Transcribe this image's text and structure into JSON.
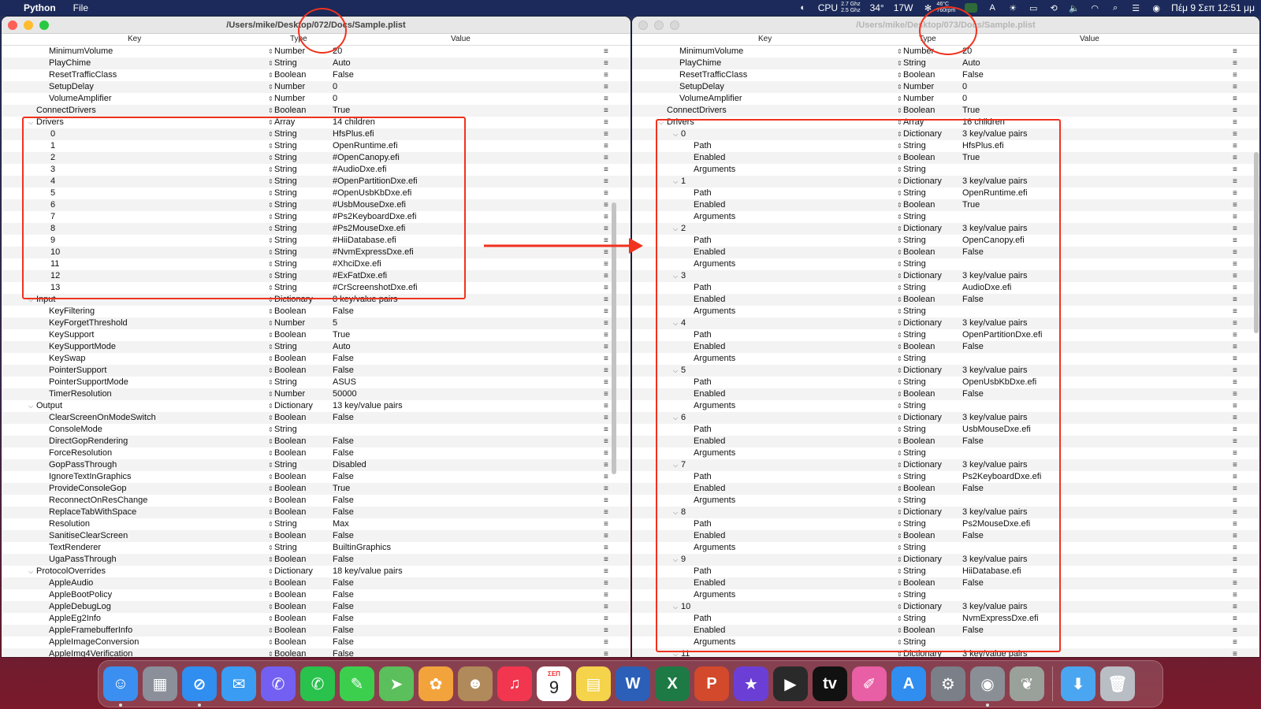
{
  "menubar": {
    "app_name": "Python",
    "menu_file": "File",
    "cpu_label": "CPU",
    "cpu_freq_1": "2.7 Ghz",
    "cpu_freq_2": "2.5 Ghz",
    "temperature": "34°",
    "power": "17W",
    "gpu_temp": "46°C",
    "fan_rpm": "760rpm",
    "datetime": "Πέμ 9 Σεπ  12:51 μμ"
  },
  "left_window": {
    "title": "/Users/mike/Desktop/072/Docs/Sample.plist",
    "headers": {
      "key": "Key",
      "type": "Type",
      "value": "Value"
    },
    "rows": [
      {
        "key": "MinimumVolume",
        "type": "Number",
        "value": "20",
        "indent": 60
      },
      {
        "key": "PlayChime",
        "type": "String",
        "value": "Auto",
        "indent": 60
      },
      {
        "key": "ResetTrafficClass",
        "type": "Boolean",
        "value": "False",
        "indent": 60
      },
      {
        "key": "SetupDelay",
        "type": "Number",
        "value": "0",
        "indent": 60
      },
      {
        "key": "VolumeAmplifier",
        "type": "Number",
        "value": "0",
        "indent": 60
      },
      {
        "key": "ConnectDrivers",
        "type": "Boolean",
        "value": "True",
        "indent": 44
      },
      {
        "key": "Drivers",
        "type": "Array",
        "value": "14 children",
        "indent": 44,
        "expanded": true
      },
      {
        "key": "0",
        "type": "String",
        "value": "HfsPlus.efi",
        "indent": 62
      },
      {
        "key": "1",
        "type": "String",
        "value": "OpenRuntime.efi",
        "indent": 62
      },
      {
        "key": "2",
        "type": "String",
        "value": "#OpenCanopy.efi",
        "indent": 62
      },
      {
        "key": "3",
        "type": "String",
        "value": "#AudioDxe.efi",
        "indent": 62
      },
      {
        "key": "4",
        "type": "String",
        "value": "#OpenPartitionDxe.efi",
        "indent": 62
      },
      {
        "key": "5",
        "type": "String",
        "value": "#OpenUsbKbDxe.efi",
        "indent": 62
      },
      {
        "key": "6",
        "type": "String",
        "value": "#UsbMouseDxe.efi",
        "indent": 62
      },
      {
        "key": "7",
        "type": "String",
        "value": "#Ps2KeyboardDxe.efi",
        "indent": 62
      },
      {
        "key": "8",
        "type": "String",
        "value": "#Ps2MouseDxe.efi",
        "indent": 62
      },
      {
        "key": "9",
        "type": "String",
        "value": "#HiiDatabase.efi",
        "indent": 62
      },
      {
        "key": "10",
        "type": "String",
        "value": "#NvmExpressDxe.efi",
        "indent": 62
      },
      {
        "key": "11",
        "type": "String",
        "value": "#XhciDxe.efi",
        "indent": 62
      },
      {
        "key": "12",
        "type": "String",
        "value": "#ExFatDxe.efi",
        "indent": 62
      },
      {
        "key": "13",
        "type": "String",
        "value": "#CrScreenshotDxe.efi",
        "indent": 62
      },
      {
        "key": "Input",
        "type": "Dictionary",
        "value": "8 key/value pairs",
        "indent": 44,
        "expanded": true
      },
      {
        "key": "KeyFiltering",
        "type": "Boolean",
        "value": "False",
        "indent": 60
      },
      {
        "key": "KeyForgetThreshold",
        "type": "Number",
        "value": "5",
        "indent": 60
      },
      {
        "key": "KeySupport",
        "type": "Boolean",
        "value": "True",
        "indent": 60
      },
      {
        "key": "KeySupportMode",
        "type": "String",
        "value": "Auto",
        "indent": 60
      },
      {
        "key": "KeySwap",
        "type": "Boolean",
        "value": "False",
        "indent": 60
      },
      {
        "key": "PointerSupport",
        "type": "Boolean",
        "value": "False",
        "indent": 60
      },
      {
        "key": "PointerSupportMode",
        "type": "String",
        "value": "ASUS",
        "indent": 60
      },
      {
        "key": "TimerResolution",
        "type": "Number",
        "value": "50000",
        "indent": 60
      },
      {
        "key": "Output",
        "type": "Dictionary",
        "value": "13 key/value pairs",
        "indent": 44,
        "expanded": true
      },
      {
        "key": "ClearScreenOnModeSwitch",
        "type": "Boolean",
        "value": "False",
        "indent": 60
      },
      {
        "key": "ConsoleMode",
        "type": "String",
        "value": "",
        "indent": 60
      },
      {
        "key": "DirectGopRendering",
        "type": "Boolean",
        "value": "False",
        "indent": 60
      },
      {
        "key": "ForceResolution",
        "type": "Boolean",
        "value": "False",
        "indent": 60
      },
      {
        "key": "GopPassThrough",
        "type": "String",
        "value": "Disabled",
        "indent": 60
      },
      {
        "key": "IgnoreTextInGraphics",
        "type": "Boolean",
        "value": "False",
        "indent": 60
      },
      {
        "key": "ProvideConsoleGop",
        "type": "Boolean",
        "value": "True",
        "indent": 60
      },
      {
        "key": "ReconnectOnResChange",
        "type": "Boolean",
        "value": "False",
        "indent": 60
      },
      {
        "key": "ReplaceTabWithSpace",
        "type": "Boolean",
        "value": "False",
        "indent": 60
      },
      {
        "key": "Resolution",
        "type": "String",
        "value": "Max",
        "indent": 60
      },
      {
        "key": "SanitiseClearScreen",
        "type": "Boolean",
        "value": "False",
        "indent": 60
      },
      {
        "key": "TextRenderer",
        "type": "String",
        "value": "BuiltinGraphics",
        "indent": 60
      },
      {
        "key": "UgaPassThrough",
        "type": "Boolean",
        "value": "False",
        "indent": 60
      },
      {
        "key": "ProtocolOverrides",
        "type": "Dictionary",
        "value": "18 key/value pairs",
        "indent": 44,
        "expanded": true
      },
      {
        "key": "AppleAudio",
        "type": "Boolean",
        "value": "False",
        "indent": 60
      },
      {
        "key": "AppleBootPolicy",
        "type": "Boolean",
        "value": "False",
        "indent": 60
      },
      {
        "key": "AppleDebugLog",
        "type": "Boolean",
        "value": "False",
        "indent": 60
      },
      {
        "key": "AppleEg2Info",
        "type": "Boolean",
        "value": "False",
        "indent": 60
      },
      {
        "key": "AppleFramebufferInfo",
        "type": "Boolean",
        "value": "False",
        "indent": 60
      },
      {
        "key": "AppleImageConversion",
        "type": "Boolean",
        "value": "False",
        "indent": 60
      },
      {
        "key": "AppleImg4Verification",
        "type": "Boolean",
        "value": "False",
        "indent": 60
      }
    ]
  },
  "right_window": {
    "title": "/Users/mike/Desktop/073/Docs/Sample.plist",
    "headers": {
      "key": "Key",
      "type": "Type",
      "value": "Value"
    },
    "rows": [
      {
        "key": "MinimumVolume",
        "type": "Number",
        "value": "20",
        "indent": 60
      },
      {
        "key": "PlayChime",
        "type": "String",
        "value": "Auto",
        "indent": 60
      },
      {
        "key": "ResetTrafficClass",
        "type": "Boolean",
        "value": "False",
        "indent": 60
      },
      {
        "key": "SetupDelay",
        "type": "Number",
        "value": "0",
        "indent": 60
      },
      {
        "key": "VolumeAmplifier",
        "type": "Number",
        "value": "0",
        "indent": 60
      },
      {
        "key": "ConnectDrivers",
        "type": "Boolean",
        "value": "True",
        "indent": 44
      },
      {
        "key": "Drivers",
        "type": "Array",
        "value": "16 children",
        "indent": 44,
        "expanded": true
      },
      {
        "key": "0",
        "type": "Dictionary",
        "value": "3 key/value pairs",
        "indent": 62,
        "expanded": true
      },
      {
        "key": "Path",
        "type": "String",
        "value": "HfsPlus.efi",
        "indent": 78
      },
      {
        "key": "Enabled",
        "type": "Boolean",
        "value": "True",
        "indent": 78
      },
      {
        "key": "Arguments",
        "type": "String",
        "value": "",
        "indent": 78
      },
      {
        "key": "1",
        "type": "Dictionary",
        "value": "3 key/value pairs",
        "indent": 62,
        "expanded": true
      },
      {
        "key": "Path",
        "type": "String",
        "value": "OpenRuntime.efi",
        "indent": 78
      },
      {
        "key": "Enabled",
        "type": "Boolean",
        "value": "True",
        "indent": 78
      },
      {
        "key": "Arguments",
        "type": "String",
        "value": "",
        "indent": 78
      },
      {
        "key": "2",
        "type": "Dictionary",
        "value": "3 key/value pairs",
        "indent": 62,
        "expanded": true
      },
      {
        "key": "Path",
        "type": "String",
        "value": "OpenCanopy.efi",
        "indent": 78
      },
      {
        "key": "Enabled",
        "type": "Boolean",
        "value": "False",
        "indent": 78
      },
      {
        "key": "Arguments",
        "type": "String",
        "value": "",
        "indent": 78
      },
      {
        "key": "3",
        "type": "Dictionary",
        "value": "3 key/value pairs",
        "indent": 62,
        "expanded": true
      },
      {
        "key": "Path",
        "type": "String",
        "value": "AudioDxe.efi",
        "indent": 78
      },
      {
        "key": "Enabled",
        "type": "Boolean",
        "value": "False",
        "indent": 78
      },
      {
        "key": "Arguments",
        "type": "String",
        "value": "",
        "indent": 78
      },
      {
        "key": "4",
        "type": "Dictionary",
        "value": "3 key/value pairs",
        "indent": 62,
        "expanded": true
      },
      {
        "key": "Path",
        "type": "String",
        "value": "OpenPartitionDxe.efi",
        "indent": 78
      },
      {
        "key": "Enabled",
        "type": "Boolean",
        "value": "False",
        "indent": 78
      },
      {
        "key": "Arguments",
        "type": "String",
        "value": "",
        "indent": 78
      },
      {
        "key": "5",
        "type": "Dictionary",
        "value": "3 key/value pairs",
        "indent": 62,
        "expanded": true
      },
      {
        "key": "Path",
        "type": "String",
        "value": "OpenUsbKbDxe.efi",
        "indent": 78
      },
      {
        "key": "Enabled",
        "type": "Boolean",
        "value": "False",
        "indent": 78
      },
      {
        "key": "Arguments",
        "type": "String",
        "value": "",
        "indent": 78
      },
      {
        "key": "6",
        "type": "Dictionary",
        "value": "3 key/value pairs",
        "indent": 62,
        "expanded": true
      },
      {
        "key": "Path",
        "type": "String",
        "value": "UsbMouseDxe.efi",
        "indent": 78
      },
      {
        "key": "Enabled",
        "type": "Boolean",
        "value": "False",
        "indent": 78
      },
      {
        "key": "Arguments",
        "type": "String",
        "value": "",
        "indent": 78
      },
      {
        "key": "7",
        "type": "Dictionary",
        "value": "3 key/value pairs",
        "indent": 62,
        "expanded": true
      },
      {
        "key": "Path",
        "type": "String",
        "value": "Ps2KeyboardDxe.efi",
        "indent": 78
      },
      {
        "key": "Enabled",
        "type": "Boolean",
        "value": "False",
        "indent": 78
      },
      {
        "key": "Arguments",
        "type": "String",
        "value": "",
        "indent": 78
      },
      {
        "key": "8",
        "type": "Dictionary",
        "value": "3 key/value pairs",
        "indent": 62,
        "expanded": true
      },
      {
        "key": "Path",
        "type": "String",
        "value": "Ps2MouseDxe.efi",
        "indent": 78
      },
      {
        "key": "Enabled",
        "type": "Boolean",
        "value": "False",
        "indent": 78
      },
      {
        "key": "Arguments",
        "type": "String",
        "value": "",
        "indent": 78
      },
      {
        "key": "9",
        "type": "Dictionary",
        "value": "3 key/value pairs",
        "indent": 62,
        "expanded": true
      },
      {
        "key": "Path",
        "type": "String",
        "value": "HiiDatabase.efi",
        "indent": 78
      },
      {
        "key": "Enabled",
        "type": "Boolean",
        "value": "False",
        "indent": 78
      },
      {
        "key": "Arguments",
        "type": "String",
        "value": "",
        "indent": 78
      },
      {
        "key": "10",
        "type": "Dictionary",
        "value": "3 key/value pairs",
        "indent": 62,
        "expanded": true
      },
      {
        "key": "Path",
        "type": "String",
        "value": "NvmExpressDxe.efi",
        "indent": 78
      },
      {
        "key": "Enabled",
        "type": "Boolean",
        "value": "False",
        "indent": 78
      },
      {
        "key": "Arguments",
        "type": "String",
        "value": "",
        "indent": 78
      },
      {
        "key": "11",
        "type": "Dictionary",
        "value": "3 key/value pairs",
        "indent": 62,
        "expanded": true
      }
    ]
  },
  "dock": {
    "calendar_month": "ΣΕΠ",
    "calendar_day": "9",
    "items": [
      {
        "name": "finder-icon",
        "glyph": "☺",
        "color": "#3b8ff0"
      },
      {
        "name": "launchpad-icon",
        "glyph": "▦",
        "color": "#8a8f9a"
      },
      {
        "name": "safari-icon",
        "glyph": "⊘",
        "color": "#2f8ef0"
      },
      {
        "name": "mail-icon",
        "glyph": "✉",
        "color": "#3a9cf2"
      },
      {
        "name": "viber-icon",
        "glyph": "✆",
        "color": "#7360f2"
      },
      {
        "name": "whatsapp-icon",
        "glyph": "✆",
        "color": "#29c24c"
      },
      {
        "name": "messages-icon",
        "glyph": "✎",
        "color": "#3ccf4e"
      },
      {
        "name": "maps-icon",
        "glyph": "➤",
        "color": "#5bbf5b"
      },
      {
        "name": "photos-icon",
        "glyph": "✿",
        "color": "#f3a33c"
      },
      {
        "name": "contacts-icon",
        "glyph": "☻",
        "color": "#b08a5a"
      },
      {
        "name": "music-icon",
        "glyph": "♫",
        "color": "#f2364f"
      },
      {
        "name": "calendar-icon",
        "glyph": "",
        "color": "#ffffff"
      },
      {
        "name": "notes-icon",
        "glyph": "▤",
        "color": "#f5d34a"
      },
      {
        "name": "word-icon",
        "glyph": "W",
        "color": "#2b5fb8"
      },
      {
        "name": "excel-icon",
        "glyph": "X",
        "color": "#1e7a44"
      },
      {
        "name": "powerpoint-icon",
        "glyph": "P",
        "color": "#d2492c"
      },
      {
        "name": "imovie-icon",
        "glyph": "★",
        "color": "#6b3fd6"
      },
      {
        "name": "final-cut-icon",
        "glyph": "▶",
        "color": "#2a2a2a"
      },
      {
        "name": "apple-tv-icon",
        "glyph": "tv",
        "color": "#111111"
      },
      {
        "name": "creativit-icon",
        "glyph": "✐",
        "color": "#e85fa5"
      },
      {
        "name": "app-store-icon",
        "glyph": "A",
        "color": "#2f8ef0"
      },
      {
        "name": "system-preferences-icon",
        "glyph": "⚙",
        "color": "#7a7f88"
      },
      {
        "name": "disk-utility-icon",
        "glyph": "◉",
        "color": "#8a8f96"
      },
      {
        "name": "opencore-configurator-icon",
        "glyph": "❦",
        "color": "#9aa09a"
      },
      {
        "name": "downloads-folder-icon",
        "glyph": "⬇",
        "color": "#4aa6f0"
      },
      {
        "name": "trash-icon",
        "glyph": "🗑",
        "color": "#b9bdc4"
      }
    ]
  },
  "colors": {
    "annotation_red": "#f0321e",
    "menubar_bg": "#1b2a5a",
    "zebra_row": "#f3f3f3"
  }
}
